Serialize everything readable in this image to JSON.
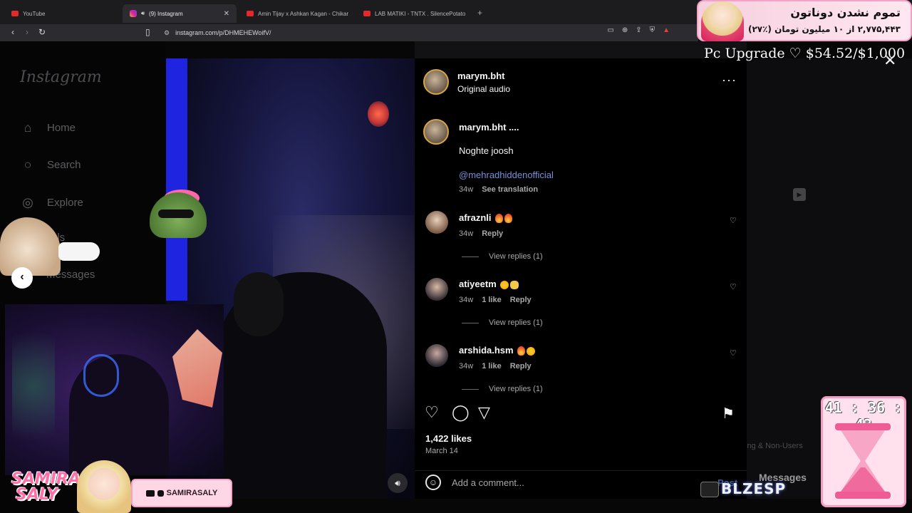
{
  "browser": {
    "tabs": [
      {
        "label": "YouTube"
      },
      {
        "label": "(9) Instagram"
      },
      {
        "label": "Amin Tijay x Ashkan Kagan - Chikar"
      },
      {
        "label": "LAB MATIKI - TNTX . SilencePotato"
      }
    ],
    "url": "instagram.com/p/DHMEHEWoifV/"
  },
  "sidebar": {
    "logo": "Instagram",
    "items": [
      {
        "label": "Home",
        "icon": "home-icon"
      },
      {
        "label": "Search",
        "icon": "search-icon"
      },
      {
        "label": "Explore",
        "icon": "compass-icon"
      },
      {
        "label": "els",
        "icon": "reels-icon"
      },
      {
        "label": "Messages",
        "icon": "messages-icon"
      }
    ]
  },
  "post": {
    "author": "marym.bht",
    "audio": "Original audio",
    "caption_user": "marym.bht ....",
    "caption_text": "Noghte joosh",
    "mention": "@mehradhiddenofficial",
    "caption_time": "34w",
    "see_translation": "See translation",
    "comments": [
      {
        "user": "afraznli",
        "time": "34w",
        "likes": "",
        "reply": "Reply",
        "view_replies": "View replies (1)"
      },
      {
        "user": "atiyeetm",
        "time": "34w",
        "likes": "1 like",
        "reply": "Reply",
        "view_replies": "View replies (1)"
      },
      {
        "user": "arshida.hsm",
        "time": "34w",
        "likes": "1 like",
        "reply": "Reply",
        "view_replies": "View replies (1)"
      }
    ],
    "likes": "1,422 likes",
    "date": "March 14",
    "comment_placeholder": "Add a comment...",
    "post_label": "Post"
  },
  "background_footer": {
    "link1": "ing & Non-Users",
    "link2": "Messages"
  },
  "overlay": {
    "donation_title": "تموم نشدن دوناتون",
    "donation_sub": "۲,۷۷۵,۴۴۳ از ۱۰ میلیون تومان (٪۲۷)",
    "upgrade": "Pc Upgrade ♡ $54.52/$1,000",
    "samira_name_line1": "SAMIRA",
    "samira_name_line2": "SALY",
    "samira_handle": "SAMIRASALY",
    "sponsor": "BLZESP",
    "timer": "41 : 36 : 43"
  },
  "colors": {
    "accent_link": "#7a8fd9",
    "panel_bg": "#000000",
    "overlay_pink": "#f49cc2"
  }
}
